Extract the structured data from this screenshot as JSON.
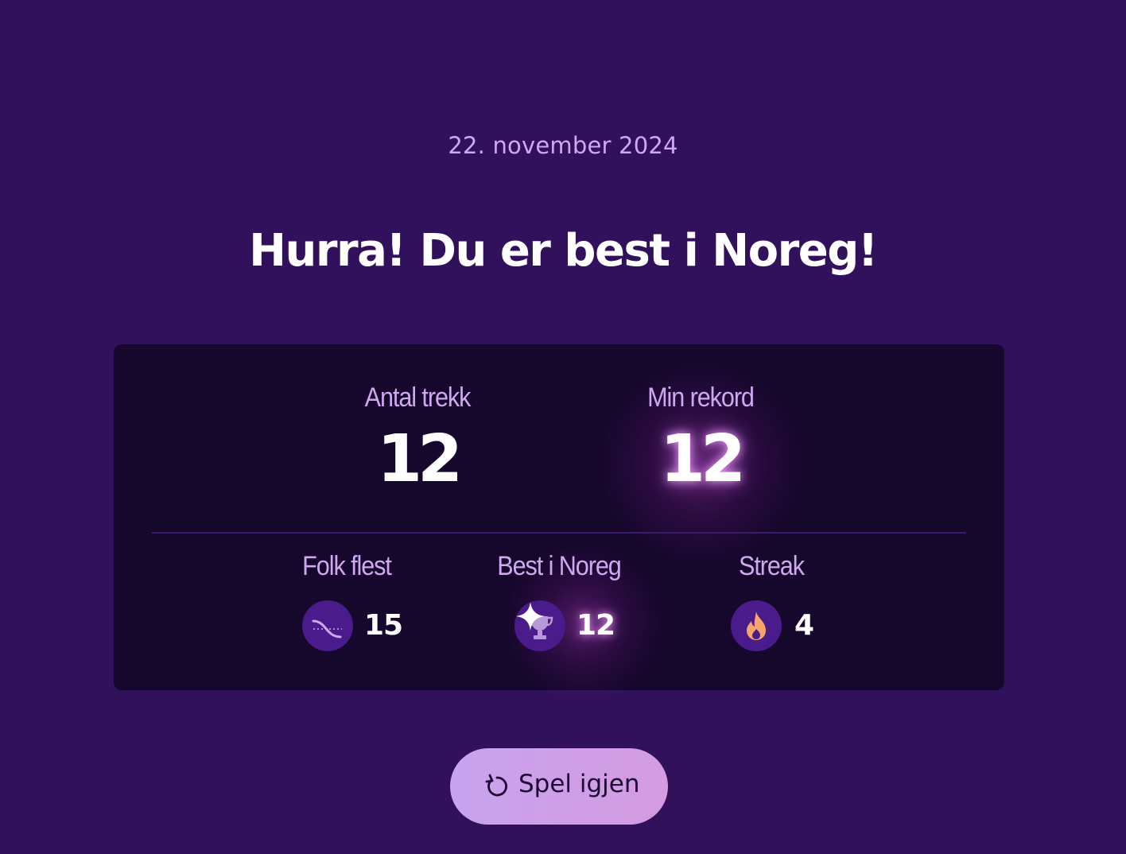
{
  "date": "22. november 2024",
  "headline": "Hurra! Du er best i Noreg!",
  "stats": {
    "moves": {
      "label": "Antal trekk",
      "value": "12"
    },
    "record": {
      "label": "Min rekord",
      "value": "12"
    }
  },
  "secondary": {
    "most_people": {
      "label": "Folk flest",
      "value": "15",
      "icon": "curve-down-icon"
    },
    "best_norway": {
      "label": "Best i Noreg",
      "value": "12",
      "icon": "trophy-icon"
    },
    "streak": {
      "label": "Streak",
      "value": "4",
      "icon": "flame-icon"
    }
  },
  "actions": {
    "play_again_label": "Spel igjen",
    "play_again_icon": "replay-icon"
  },
  "colors": {
    "background": "#32115c",
    "card": "#16072c",
    "accent_text": "#cfa8f0",
    "badge": "#4a1b8a",
    "button": "#c8a3ee",
    "flame": "#f5a46a"
  }
}
